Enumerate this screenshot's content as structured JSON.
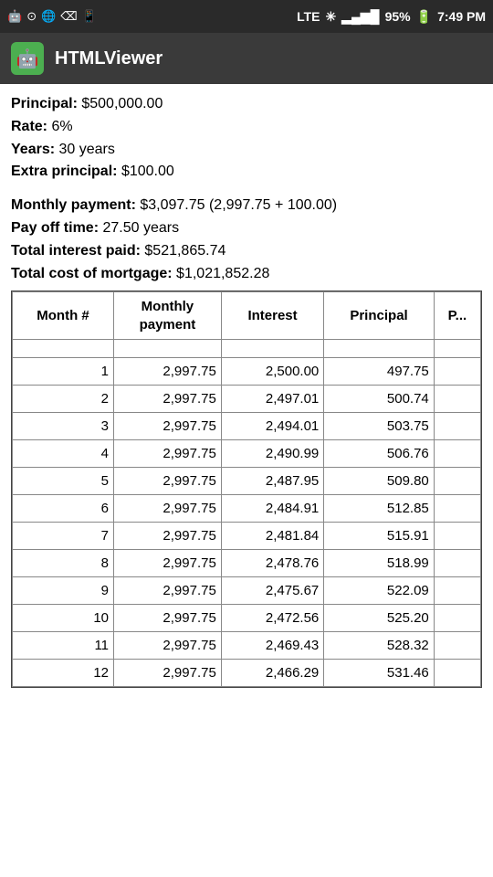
{
  "statusBar": {
    "leftIcons": [
      "wifi-icon",
      "globe-icon",
      "usb-icon",
      "android-icon"
    ],
    "network": "LTE",
    "signal": "95%",
    "time": "7:49 PM"
  },
  "appBar": {
    "title": "HTMLViewer",
    "iconLabel": "🤖"
  },
  "mortgage": {
    "principal_label": "Principal:",
    "principal_value": "$500,000.00",
    "rate_label": "Rate:",
    "rate_value": "6%",
    "years_label": "Years:",
    "years_value": "30 years",
    "extra_principal_label": "Extra principal:",
    "extra_principal_value": "$100.00",
    "monthly_payment_label": "Monthly payment:",
    "monthly_payment_value": "$3,097.75 (2,997.75 + 100.00)",
    "payoff_label": "Pay off time:",
    "payoff_value": "27.50 years",
    "total_interest_label": "Total interest paid:",
    "total_interest_value": "$521,865.74",
    "total_cost_label": "Total cost of mortgage:",
    "total_cost_value": "$1,021,852.28"
  },
  "table": {
    "headers": [
      "Month #",
      "Monthly\npayment",
      "Interest",
      "Principal",
      "P..."
    ],
    "emptyRow": true,
    "rows": [
      {
        "month": 1,
        "payment": "2,997.75",
        "interest": "2,500.00",
        "principal": "497.75",
        "extra": ""
      },
      {
        "month": 2,
        "payment": "2,997.75",
        "interest": "2,497.01",
        "principal": "500.74",
        "extra": ""
      },
      {
        "month": 3,
        "payment": "2,997.75",
        "interest": "2,494.01",
        "principal": "503.75",
        "extra": ""
      },
      {
        "month": 4,
        "payment": "2,997.75",
        "interest": "2,490.99",
        "principal": "506.76",
        "extra": ""
      },
      {
        "month": 5,
        "payment": "2,997.75",
        "interest": "2,487.95",
        "principal": "509.80",
        "extra": ""
      },
      {
        "month": 6,
        "payment": "2,997.75",
        "interest": "2,484.91",
        "principal": "512.85",
        "extra": ""
      },
      {
        "month": 7,
        "payment": "2,997.75",
        "interest": "2,481.84",
        "principal": "515.91",
        "extra": ""
      },
      {
        "month": 8,
        "payment": "2,997.75",
        "interest": "2,478.76",
        "principal": "518.99",
        "extra": ""
      },
      {
        "month": 9,
        "payment": "2,997.75",
        "interest": "2,475.67",
        "principal": "522.09",
        "extra": ""
      },
      {
        "month": 10,
        "payment": "2,997.75",
        "interest": "2,472.56",
        "principal": "525.20",
        "extra": ""
      },
      {
        "month": 11,
        "payment": "2,997.75",
        "interest": "2,469.43",
        "principal": "528.32",
        "extra": ""
      },
      {
        "month": 12,
        "payment": "2,997.75",
        "interest": "2,466.29",
        "principal": "531.46",
        "extra": ""
      }
    ]
  }
}
